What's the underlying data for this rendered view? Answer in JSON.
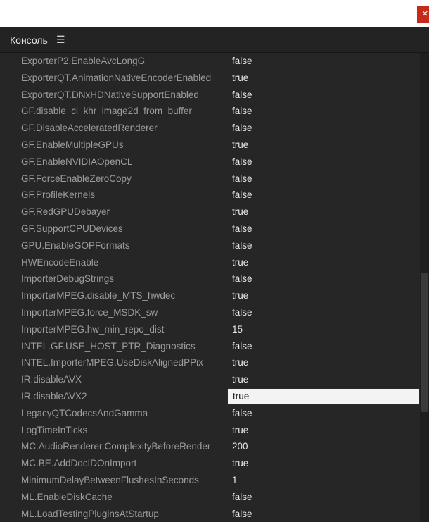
{
  "window": {
    "close_glyph": "×"
  },
  "panel": {
    "title": "Консоль",
    "menu_glyph": "☰"
  },
  "rows": [
    {
      "key": "ExporterP2.EnableAvcLongG",
      "value": "false"
    },
    {
      "key": "ExporterQT.AnimationNativeEncoderEnabled",
      "value": "true"
    },
    {
      "key": "ExporterQT.DNxHDNativeSupportEnabled",
      "value": "false"
    },
    {
      "key": "GF.disable_cl_khr_image2d_from_buffer",
      "value": "false"
    },
    {
      "key": "GF.DisableAcceleratedRenderer",
      "value": "false"
    },
    {
      "key": "GF.EnableMultipleGPUs",
      "value": "true"
    },
    {
      "key": "GF.EnableNVIDIAOpenCL",
      "value": "false"
    },
    {
      "key": "GF.ForceEnableZeroCopy",
      "value": "false"
    },
    {
      "key": "GF.ProfileKernels",
      "value": "false"
    },
    {
      "key": "GF.RedGPUDebayer",
      "value": "true"
    },
    {
      "key": "GF.SupportCPUDevices",
      "value": "false"
    },
    {
      "key": "GPU.EnableGOPFormats",
      "value": "false"
    },
    {
      "key": "HWEncodeEnable",
      "value": "true"
    },
    {
      "key": "ImporterDebugStrings",
      "value": "false"
    },
    {
      "key": "ImporterMPEG.disable_MTS_hwdec",
      "value": "true"
    },
    {
      "key": "ImporterMPEG.force_MSDK_sw",
      "value": "false"
    },
    {
      "key": "ImporterMPEG.hw_min_repo_dist",
      "value": "15"
    },
    {
      "key": "INTEL.GF.USE_HOST_PTR_Diagnostics",
      "value": "false"
    },
    {
      "key": "INTEL.ImporterMPEG.UseDiskAlignedPPix",
      "value": "true"
    },
    {
      "key": "IR.disableAVX",
      "value": "true"
    },
    {
      "key": "IR.disableAVX2",
      "value": "true",
      "selected": true
    },
    {
      "key": "LegacyQTCodecsAndGamma",
      "value": "false"
    },
    {
      "key": "LogTimeInTicks",
      "value": "true"
    },
    {
      "key": "MC.AudioRenderer.ComplexityBeforeRender",
      "value": "200"
    },
    {
      "key": "MC.BE.AddDocIDOnImport",
      "value": "true"
    },
    {
      "key": "MinimumDelayBetweenFlushesInSeconds",
      "value": "1"
    },
    {
      "key": "ML.EnableDiskCache",
      "value": "false"
    },
    {
      "key": "ML.LoadTestingPluginsAtStartup",
      "value": "false"
    }
  ]
}
